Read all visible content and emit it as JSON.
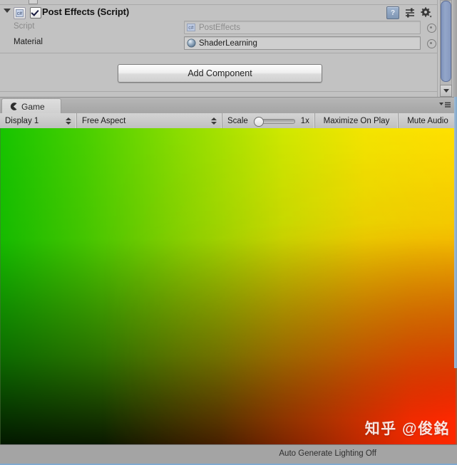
{
  "inspector": {
    "component": {
      "title": "Post Effects (Script)",
      "enabled_checkbox": true,
      "foldout_expanded": true,
      "icons": {
        "help": "?",
        "preset": "preset-icon",
        "settings": "gear-icon"
      }
    },
    "properties": [
      {
        "label": "Script",
        "value": "PostEffects",
        "disabled": true,
        "icon": "script-asset-icon"
      },
      {
        "label": "Material",
        "value": "ShaderLearning",
        "disabled": false,
        "icon": "material-sphere-icon"
      }
    ],
    "add_component_label": "Add Component"
  },
  "game": {
    "tab_label": "Game",
    "tab_icon": "game-view-icon",
    "toolbar": {
      "display": "Display 1",
      "aspect": "Free Aspect",
      "scale_label": "Scale",
      "scale_value": "1x",
      "maximize_on_play": "Maximize On Play",
      "mute_audio": "Mute Audio"
    },
    "render": {
      "watermark": "知乎 @俊銘",
      "auto_generate_lighting": "Auto Generate Lighting Off"
    }
  },
  "colors": {
    "gradient_top_left": "#16c400",
    "gradient_top_right": "#ffe000",
    "gradient_bottom_left": "#0b1a00",
    "gradient_bottom_right": "#ff2800",
    "panel_bg": "#c2c2c2",
    "scrollbar_thumb": "#8699c0",
    "accent_border": "#7fa8cf"
  }
}
